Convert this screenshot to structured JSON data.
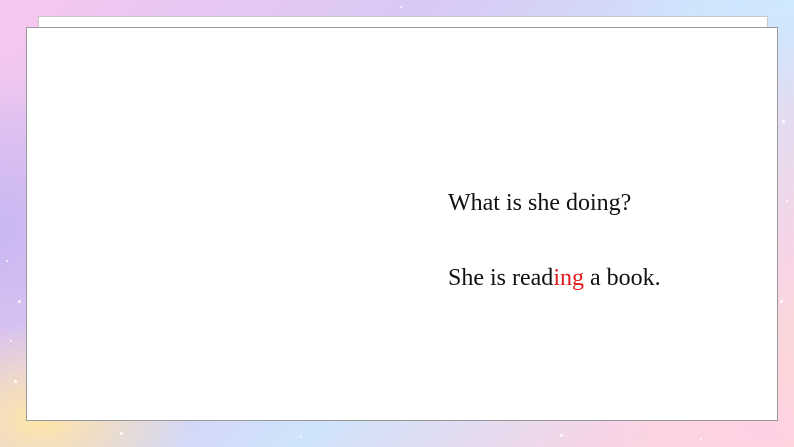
{
  "slide": {
    "question": "What is she doing?",
    "answer": {
      "before": "She is read",
      "highlight": "ing",
      "after": " a book."
    },
    "highlight_color": "#e01b1b"
  }
}
